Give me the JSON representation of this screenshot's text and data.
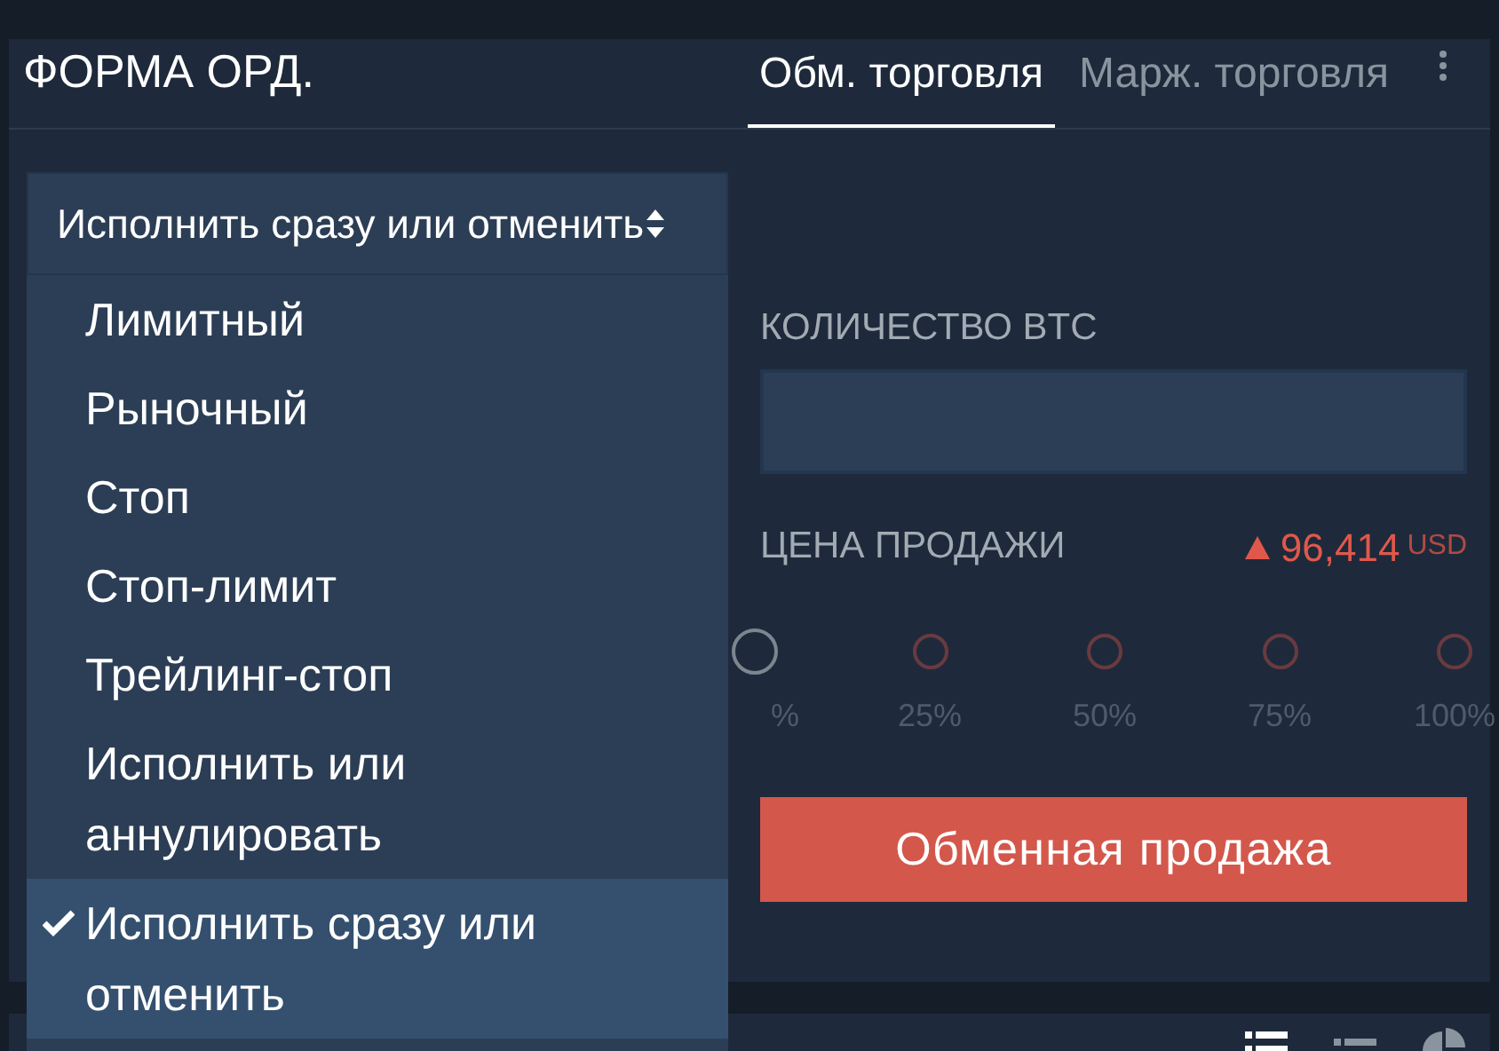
{
  "panel": {
    "title": "ФОРМА ОРД.",
    "tabs": [
      {
        "label": "Обм. торговля",
        "selected": true
      },
      {
        "label": "Марж. торговля",
        "selected": false
      }
    ]
  },
  "order_type": {
    "value": "Исполнить сразу или отменить",
    "options": [
      {
        "label": "Лимитный",
        "selected": false
      },
      {
        "label": "Рыночный",
        "selected": false
      },
      {
        "label": "Стоп",
        "selected": false
      },
      {
        "label": "Стоп-лимит",
        "selected": false
      },
      {
        "label": "Трейлинг-стоп",
        "selected": false
      },
      {
        "label": "Исполнить или аннулировать",
        "selected": false
      },
      {
        "label": "Исполнить сразу или отменить",
        "selected": true
      }
    ]
  },
  "quantity": {
    "label": "КОЛИЧЕСТВО BTC"
  },
  "price": {
    "label": "ЦЕНА ПРОДАЖИ",
    "value": "96,414",
    "currency": "USD"
  },
  "slider": {
    "marks": [
      "%",
      "25%",
      "50%",
      "75%",
      "100%"
    ]
  },
  "sell_button": "Обменная продажа"
}
